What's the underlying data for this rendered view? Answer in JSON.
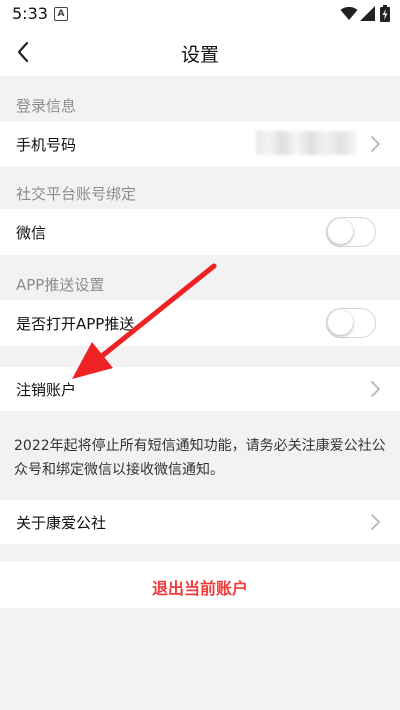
{
  "status_bar": {
    "time": "5:33",
    "notification_icon": "A"
  },
  "header": {
    "title": "设置"
  },
  "sections": {
    "login": {
      "title": "登录信息",
      "phone_label": "手机号码"
    },
    "social": {
      "title": "社交平台账号绑定",
      "wechat_label": "微信",
      "wechat_enabled": false
    },
    "push": {
      "title": "APP推送设置",
      "push_label": "是否打开APP推送",
      "push_enabled": false
    }
  },
  "account": {
    "cancel_label": "注销账户"
  },
  "notice": {
    "text": "2022年起将停止所有短信通知功能，请务必关注康爱公社公众号和绑定微信以接收微信通知。"
  },
  "about": {
    "label": "关于康爱公社"
  },
  "logout": {
    "label": "退出当前账户"
  },
  "colors": {
    "accent_red": "#f23a3a",
    "background": "#f2f2f2",
    "annotation_arrow": "#ee2222"
  },
  "icons": {
    "back": "chevron-left-icon",
    "row_arrow": "chevron-right-icon"
  }
}
